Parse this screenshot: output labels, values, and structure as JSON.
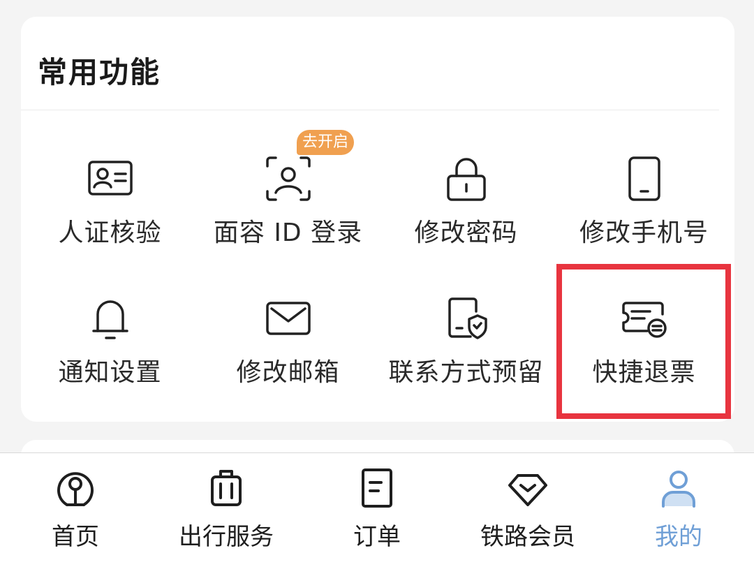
{
  "section": {
    "title": "常用功能",
    "items": [
      {
        "label": "人证核验",
        "icon": "id-card-icon"
      },
      {
        "label": "面容 ID 登录",
        "icon": "face-id-icon",
        "badge": "去开启"
      },
      {
        "label": "修改密码",
        "icon": "lock-icon"
      },
      {
        "label": "修改手机号",
        "icon": "phone-icon"
      },
      {
        "label": "通知设置",
        "icon": "bell-icon"
      },
      {
        "label": "修改邮箱",
        "icon": "mail-icon"
      },
      {
        "label": "联系方式预留",
        "icon": "shield-doc-icon"
      },
      {
        "label": "快捷退票",
        "icon": "ticket-refund-icon"
      }
    ]
  },
  "tabbar": {
    "tabs": [
      {
        "label": "首页",
        "icon": "railway-logo-icon",
        "active": false
      },
      {
        "label": "出行服务",
        "icon": "luggage-icon",
        "active": false
      },
      {
        "label": "订单",
        "icon": "order-doc-icon",
        "active": false
      },
      {
        "label": "铁路会员",
        "icon": "diamond-icon",
        "active": false
      },
      {
        "label": "我的",
        "icon": "person-icon",
        "active": true
      }
    ]
  },
  "colors": {
    "highlight": "#e8343f",
    "badge": "#f0a050",
    "active_tab": "#6f9fd6",
    "background": "#f4f4f4"
  }
}
